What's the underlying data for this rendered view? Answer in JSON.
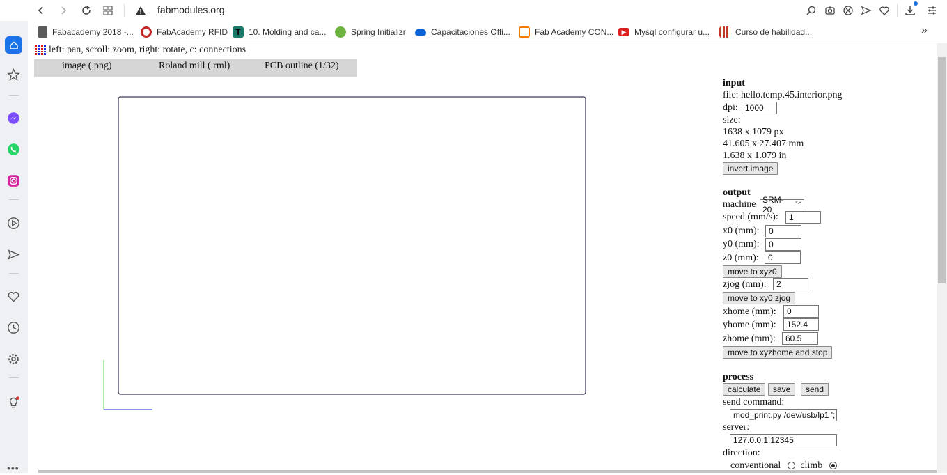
{
  "browser": {
    "url": "fabmodules.org",
    "bookmarks": [
      {
        "label": "Fabacademy 2018 -...",
        "icon": "document-icon",
        "color": "#555555"
      },
      {
        "label": "FabAcademy RFID",
        "icon": "fab-logo-icon",
        "color": "#c62828"
      },
      {
        "label": "10. Molding and ca...",
        "icon": "fab-t-icon",
        "color": "#1a7a6a"
      },
      {
        "label": "Spring Initializr",
        "icon": "spring-icon",
        "color": "#6db33f"
      },
      {
        "label": "Capacitaciones Offi...",
        "icon": "cloud-icon",
        "color": "#0a64d8"
      },
      {
        "label": "Fab Academy CON...",
        "icon": "orange-box-icon",
        "color": "#f57c00"
      },
      {
        "label": "Mysql configurar u...",
        "icon": "youtube-icon",
        "color": "#e02020"
      },
      {
        "label": "Curso de habilidad...",
        "icon": "pixel-icon",
        "color": "#c0392b"
      }
    ]
  },
  "page": {
    "hint": "left: pan, scroll: zoom, right: rotate, c: connections",
    "tabs": [
      "image (.png)",
      "Roland mill (.rml)",
      "PCB outline (1/32)"
    ]
  },
  "panel": {
    "input": {
      "heading": "input",
      "file": "file: hello.temp.45.interior.png",
      "dpi_label": "dpi:",
      "dpi": "1000",
      "size_label": "size:",
      "size_px": "1638 x 1079 px",
      "size_mm": "41.605 x 27.407 mm",
      "size_in": "1.638 x 1.079 in",
      "invert": "invert image"
    },
    "output": {
      "heading": "output",
      "machine_label": "machine",
      "machine": "SRM-20",
      "speed_label": "speed (mm/s):",
      "speed": "1",
      "x0_label": "x0 (mm):",
      "x0": "0",
      "y0_label": "y0 (mm):",
      "y0": "0",
      "z0_label": "z0 (mm):",
      "z0": "0",
      "move_xyz0": "move to xyz0",
      "zjog_label": "zjog (mm):",
      "zjog": "2",
      "move_xy0_zjog": "move to xy0 zjog",
      "xhome_label": "xhome (mm):",
      "xhome": "0",
      "yhome_label": "yhome (mm):",
      "yhome": "152.4",
      "zhome_label": "zhome (mm):",
      "zhome": "60.5",
      "move_home": "move to xyzhome and stop"
    },
    "process": {
      "heading": "process",
      "calculate": "calculate",
      "save": "save",
      "send": "send",
      "send_command_label": "send command:",
      "send_command": "mod_print.py /dev/usb/lp1 ';",
      "server_label": "server:",
      "server": "127.0.0.1:12345",
      "direction_label": "direction:",
      "conventional": "conventional",
      "climb": "climb"
    }
  }
}
